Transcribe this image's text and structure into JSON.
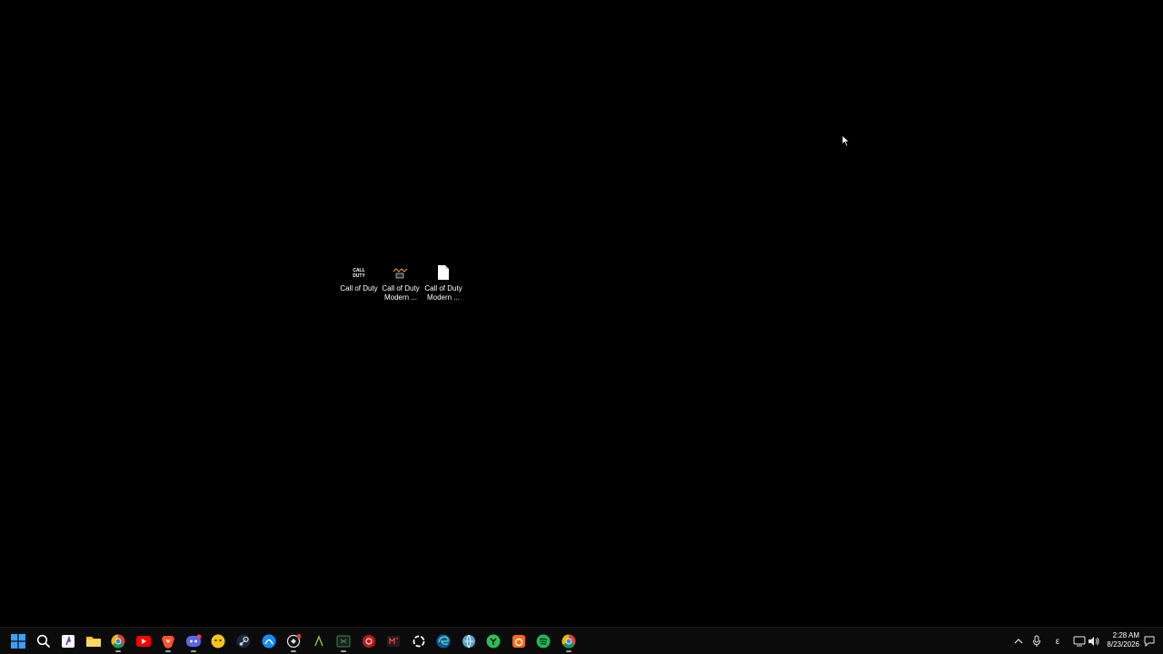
{
  "desktop": {
    "background": "#000000",
    "icons": [
      {
        "label": "Call of Duty",
        "icon": "cod-logo-icon"
      },
      {
        "label": "Call of Duty\nModern ...",
        "icon": "cod-mw-app-icon"
      },
      {
        "label": "Call of Duty\nModern ...",
        "icon": "file-icon"
      }
    ]
  },
  "taskbar": {
    "background": "#0b0b0b",
    "apps": [
      "start-icon",
      "search-icon",
      "app-icon",
      "file-explorer-icon",
      "chrome-icon",
      "youtube-icon",
      "brave-icon",
      "discord-icon",
      "app-icon",
      "steam-icon",
      "battlenet-icon",
      "app-icon",
      "app-icon",
      "terminal-icon",
      "app-icon",
      "app-icon",
      "app-icon",
      "edge-icon",
      "app-icon",
      "app-icon",
      "app-icon",
      "spotify-icon",
      "chrome-icon"
    ],
    "tray": {
      "chevron": "^",
      "mic": "microphone-icon",
      "lang": "ε",
      "network": "network-icon",
      "volume": "volume-icon"
    },
    "clock": {
      "time": "2:28 AM",
      "date": "8/23/2026"
    }
  }
}
